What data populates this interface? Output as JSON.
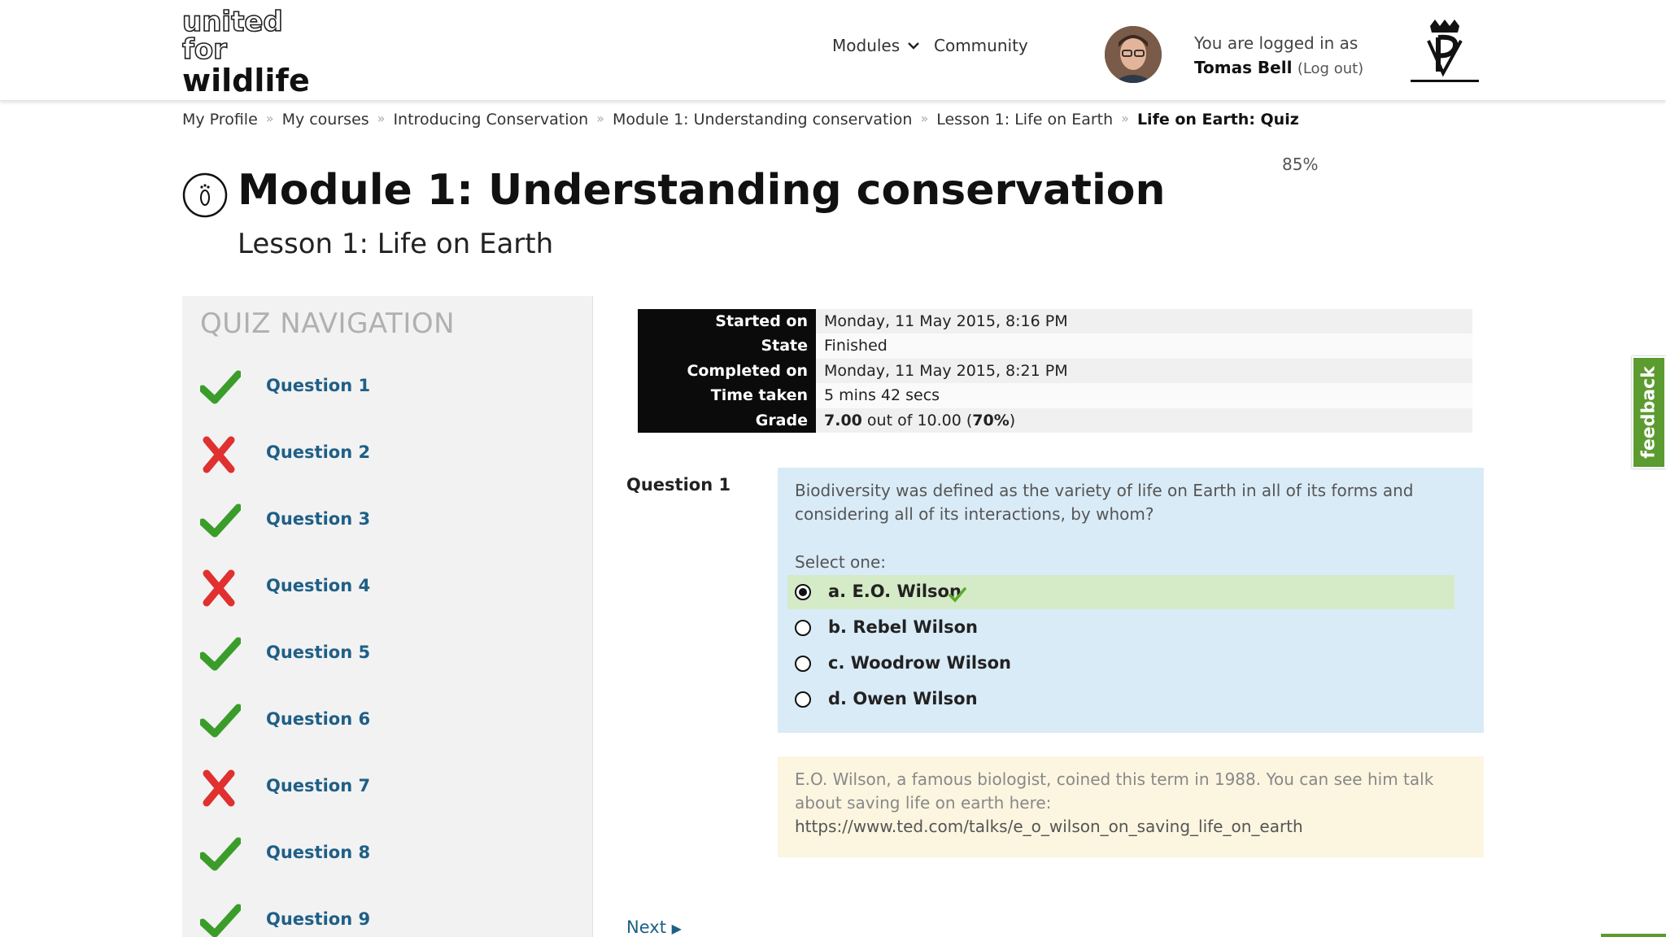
{
  "header": {
    "logo": [
      "united",
      "for",
      "wildlife"
    ],
    "nav": {
      "modules": "Modules",
      "community": "Community"
    },
    "login": {
      "prefix": "You are logged in as",
      "name": "Tomas Bell",
      "logout": "(Log out)"
    }
  },
  "breadcrumb": [
    "My Profile",
    "My courses",
    "Introducing Conservation",
    "Module 1: Understanding conservation",
    "Lesson 1: Life on Earth",
    "Life on Earth: Quiz"
  ],
  "progress": "85%",
  "page": {
    "title": "Module 1: Understanding conservation",
    "subtitle": "Lesson 1: Life on Earth"
  },
  "quiz_nav": {
    "title": "QUIZ NAVIGATION",
    "questions": [
      {
        "label": "Question 1",
        "status": "correct"
      },
      {
        "label": "Question 2",
        "status": "incorrect"
      },
      {
        "label": "Question 3",
        "status": "correct"
      },
      {
        "label": "Question 4",
        "status": "incorrect"
      },
      {
        "label": "Question 5",
        "status": "correct"
      },
      {
        "label": "Question 6",
        "status": "correct"
      },
      {
        "label": "Question 7",
        "status": "incorrect"
      },
      {
        "label": "Question 8",
        "status": "correct"
      },
      {
        "label": "Question 9",
        "status": "correct"
      }
    ]
  },
  "summary": [
    {
      "key": "Started on",
      "value": "Monday, 11 May 2015, 8:16 PM"
    },
    {
      "key": "State",
      "value": "Finished"
    },
    {
      "key": "Completed on",
      "value": "Monday, 11 May 2015, 8:21 PM"
    },
    {
      "key": "Time taken",
      "value": "5 mins 42 secs"
    },
    {
      "key": "Grade",
      "value_bold": "7.00",
      "value_mid": " out of 10.00 (",
      "value_pct": "70%",
      "value_end": ")"
    }
  ],
  "question": {
    "number": "Question 1",
    "text": "Biodiversity was defined as the variety of life on Earth in all of its forms and considering all of its interactions, by whom?",
    "select_label": "Select one:",
    "options": [
      {
        "label": "a. E.O. Wilson",
        "selected": true,
        "correct": true
      },
      {
        "label": "b. Rebel Wilson",
        "selected": false,
        "correct": false
      },
      {
        "label": "c. Woodrow Wilson",
        "selected": false,
        "correct": false
      },
      {
        "label": "d. Owen Wilson",
        "selected": false,
        "correct": false
      }
    ],
    "feedback": "E.O. Wilson, a famous biologist, coined this term in 1988. You can see him talk about saving life on earth here:",
    "feedback_link": "https://www.ted.com/talks/e_o_wilson_on_saving_life_on_earth"
  },
  "next_label": "Next",
  "feedback_tab": "feedback",
  "colors": {
    "correct": "#3a9d2a",
    "incorrect": "#e03030",
    "link": "#1f5f87",
    "feedback_tab": "#5b9b2f"
  },
  "icons": {
    "correct": "check-icon",
    "incorrect": "cross-icon",
    "modules": "chevron-down-icon",
    "title": "footprint-icon"
  }
}
